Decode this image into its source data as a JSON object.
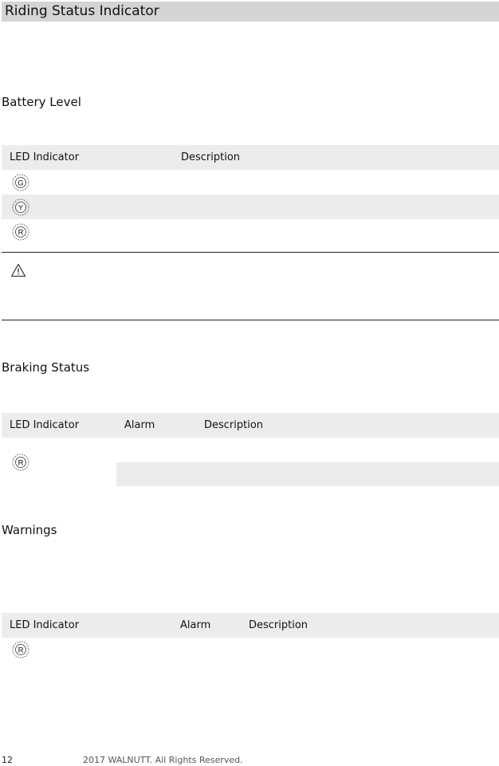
{
  "title": "Riding Status Indicator",
  "battery": {
    "heading": "Battery Level",
    "col_led": "LED Indicator",
    "col_description": "Description",
    "rows": [
      {
        "led": "G"
      },
      {
        "led": "Y"
      },
      {
        "led": "R"
      }
    ]
  },
  "braking": {
    "heading": "Braking Status",
    "col_led": "LED Indicator",
    "col_alarm": "Alarm",
    "col_description": "Description",
    "led": "R"
  },
  "warnings": {
    "heading": "Warnings",
    "col_led": "LED Indicator",
    "col_alarm": "Alarm",
    "col_description": "Description",
    "led": "R"
  },
  "footer": {
    "page_number": "12",
    "copyright": "2017 WALNUTT. All Rights Reserved."
  }
}
